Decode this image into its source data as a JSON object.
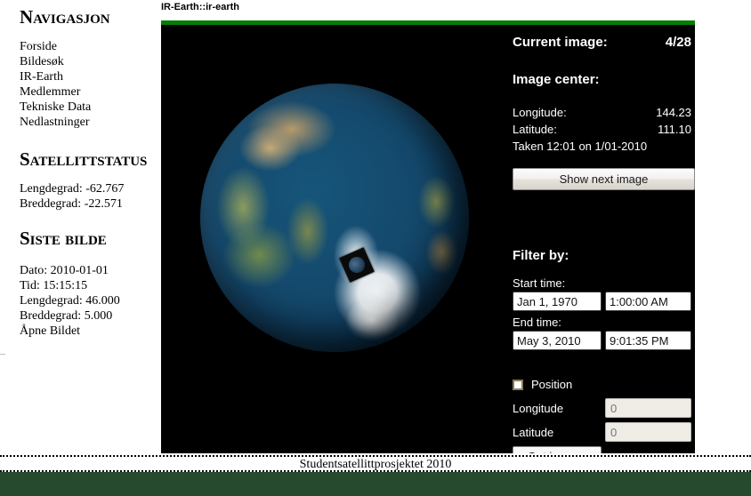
{
  "page": {
    "title": "IR-Earth::ir-earth",
    "footer_text": "Studentsatellittprosjektet 2010",
    "accent_green": "#047d04",
    "footer_band_green": "#264a2e",
    "panel_background": "#000000"
  },
  "sidebar": {
    "navigation": {
      "heading": "Navigasjon",
      "items": [
        {
          "label": "Forside"
        },
        {
          "label": "Bildesøk"
        },
        {
          "label": "IR-Earth"
        },
        {
          "label": "Medlemmer"
        },
        {
          "label": "Tekniske Data"
        },
        {
          "label": "Nedlastninger"
        }
      ]
    },
    "satellite_status": {
      "heading": "Satellittstatus",
      "items": [
        {
          "label": "Lengdegrad: -62.767"
        },
        {
          "label": "Breddegrad: -22.571"
        }
      ]
    },
    "last_image": {
      "heading": "Siste bilde",
      "items": [
        {
          "label": "Dato: 2010-01-01"
        },
        {
          "label": "Tid: 15:15:15"
        },
        {
          "label": "Lengdegrad: 46.000"
        },
        {
          "label": "Breddegrad: 5.000"
        },
        {
          "label": "Åpne Bildet"
        }
      ]
    }
  },
  "viewer": {
    "current_image_label": "Current image:",
    "current_image_value": "4/28",
    "image_center_heading": "Image center:",
    "longitude_label": "Longitude:",
    "longitude_value": "144.23",
    "latitude_label": "Latitude:",
    "latitude_value": "111.10",
    "taken_text": "Taken 12:01 on 1/01-2010",
    "show_next_button": "Show next image"
  },
  "filter": {
    "heading": "Filter by:",
    "start_time_label": "Start time:",
    "start_date_value": "Jan 1, 1970",
    "start_clock_value": "1:00:00 AM",
    "end_time_label": "End time:",
    "end_date_value": "May 3, 2010",
    "end_clock_value": "9:01:35 PM",
    "position_label": "Position",
    "position_checked": false,
    "longitude_label": "Longitude",
    "longitude_placeholder": "0",
    "latitude_label": "Latitude",
    "latitude_placeholder": "0",
    "get_images_button": "Get images"
  }
}
